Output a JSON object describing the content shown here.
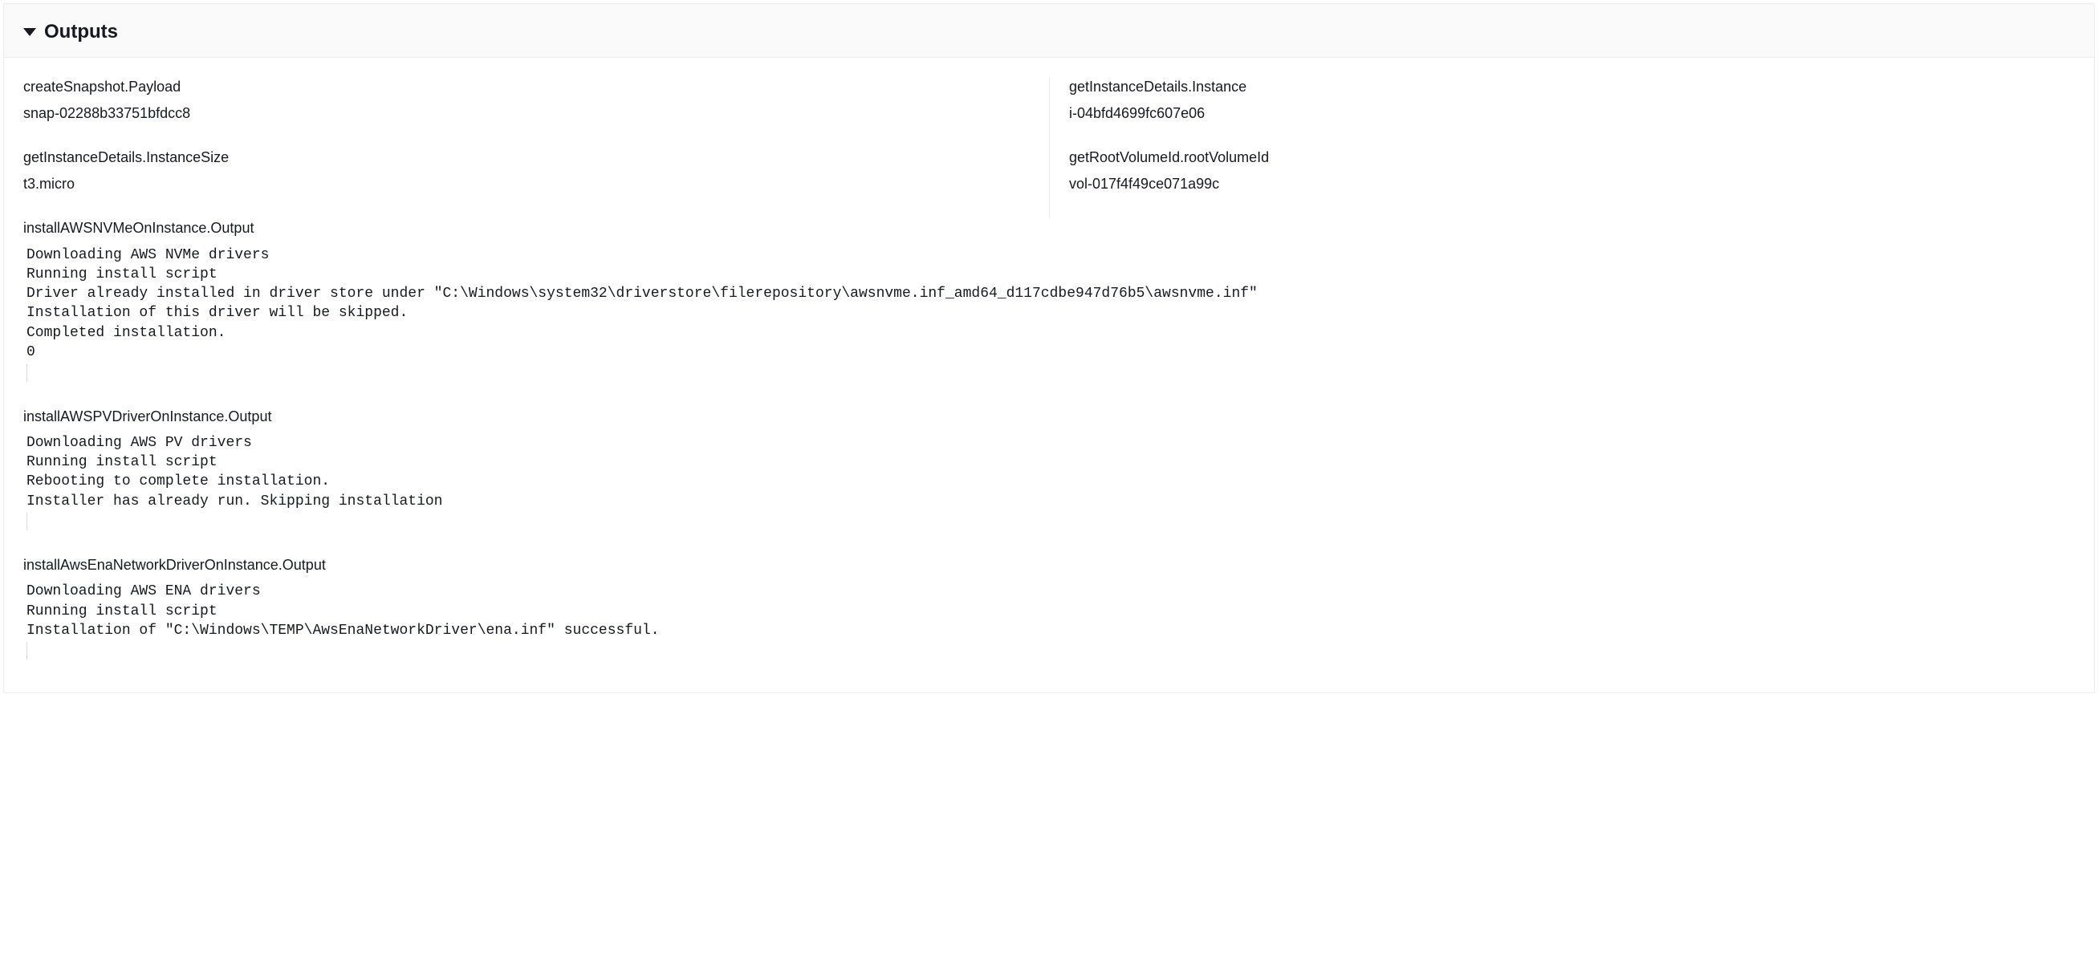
{
  "panel": {
    "title": "Outputs"
  },
  "fields": {
    "createSnapshotPayload": {
      "label": "createSnapshot.Payload",
      "value": "snap-02288b33751bfdcc8"
    },
    "getInstanceDetailsInstance": {
      "label": "getInstanceDetails.Instance",
      "value": "i-04bfd4699fc607e06"
    },
    "getInstanceDetailsInstanceSize": {
      "label": "getInstanceDetails.InstanceSize",
      "value": "t3.micro"
    },
    "getRootVolumeIdRootVolumeId": {
      "label": "getRootVolumeId.rootVolumeId",
      "value": "vol-017f4f49ce071a99c"
    }
  },
  "blocks": {
    "installAWSNVMeOnInstance": {
      "label": "installAWSNVMeOnInstance.Output",
      "text": "Downloading AWS NVMe drivers\nRunning install script\nDriver already installed in driver store under \"C:\\Windows\\system32\\driverstore\\filerepository\\awsnvme.inf_amd64_d117cdbe947d76b5\\awsnvme.inf\"\nInstallation of this driver will be skipped.\nCompleted installation.\n0"
    },
    "installAWSPVDriverOnInstance": {
      "label": "installAWSPVDriverOnInstance.Output",
      "text": "Downloading AWS PV drivers\nRunning install script\nRebooting to complete installation.\nInstaller has already run. Skipping installation"
    },
    "installAwsEnaNetworkDriverOnInstance": {
      "label": "installAwsEnaNetworkDriverOnInstance.Output",
      "text": "Downloading AWS ENA drivers\nRunning install script\nInstallation of \"C:\\Windows\\TEMP\\AwsEnaNetworkDriver\\ena.inf\" successful."
    }
  }
}
